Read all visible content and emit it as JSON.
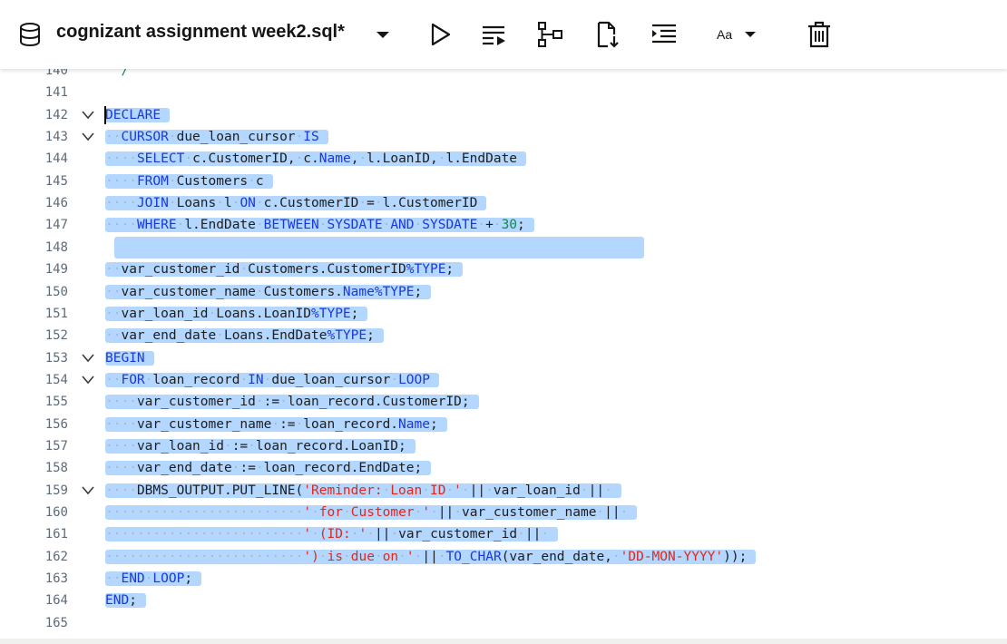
{
  "toolbar": {
    "title": "cognizant assignment week2.sql*",
    "font_label": "Aa",
    "icons": [
      "database-icon",
      "dropdown-caret-icon",
      "run-icon",
      "run-script-icon",
      "explain-plan-icon",
      "download-icon",
      "format-icon",
      "font-size-icon",
      "trash-icon"
    ]
  },
  "editor": {
    "lines": [
      {
        "n": "140",
        "code": "  /"
      },
      {
        "n": "141",
        "code": ""
      },
      {
        "n": "142",
        "code": "DECLARE",
        "fold": true
      },
      {
        "n": "143",
        "code": "··CURSOR·due_loan_cursor·IS",
        "fold": true
      },
      {
        "n": "144",
        "code": "····SELECT·c.CustomerID,·c.Name,·l.LoanID,·l.EndDate"
      },
      {
        "n": "145",
        "code": "····FROM·Customers·c"
      },
      {
        "n": "146",
        "code": "····JOIN·Loans·l·ON·c.CustomerID·=·l.CustomerID"
      },
      {
        "n": "147",
        "code": "····WHERE·l.EndDate·BETWEEN·SYSDATE·AND·SYSDATE·+·30;"
      },
      {
        "n": "148",
        "code": ""
      },
      {
        "n": "149",
        "code": "··var_customer_id·Customers.CustomerID%TYPE;"
      },
      {
        "n": "150",
        "code": "··var_customer_name·Customers.Name%TYPE;"
      },
      {
        "n": "151",
        "code": "··var_loan_id·Loans.LoanID%TYPE;"
      },
      {
        "n": "152",
        "code": "··var_end_date·Loans.EndDate%TYPE;"
      },
      {
        "n": "153",
        "code": "BEGIN",
        "fold": true
      },
      {
        "n": "154",
        "code": "··FOR·loan_record·IN·due_loan_cursor·LOOP",
        "fold": true
      },
      {
        "n": "155",
        "code": "····var_customer_id·:=·loan_record.CustomerID;"
      },
      {
        "n": "156",
        "code": "····var_customer_name·:=·loan_record.Name;"
      },
      {
        "n": "157",
        "code": "····var_loan_id·:=·loan_record.LoanID;"
      },
      {
        "n": "158",
        "code": "····var_end_date·:=·loan_record.EndDate;"
      },
      {
        "n": "159",
        "code": "····DBMS_OUTPUT.PUT_LINE('Reminder:·Loan·ID·'·||·var_loan_id·||·",
        "fold": true
      },
      {
        "n": "160",
        "code": "·························'·for·Customer·'·||·var_customer_name·||·"
      },
      {
        "n": "161",
        "code": "·························'·(ID:·'·||·var_customer_id·||·"
      },
      {
        "n": "162",
        "code": "·························')·is·due·on·'·||·TO_CHAR(var_end_date,·'DD-MON-YYYY'));"
      },
      {
        "n": "163",
        "code": "··END·LOOP;"
      },
      {
        "n": "164",
        "code": "END;"
      },
      {
        "n": "165",
        "code": ""
      }
    ]
  },
  "colors": {
    "selection": "#b3d7ff",
    "keyword": "#1a39d8",
    "string": "#e0281a",
    "number": "#108a4a"
  }
}
